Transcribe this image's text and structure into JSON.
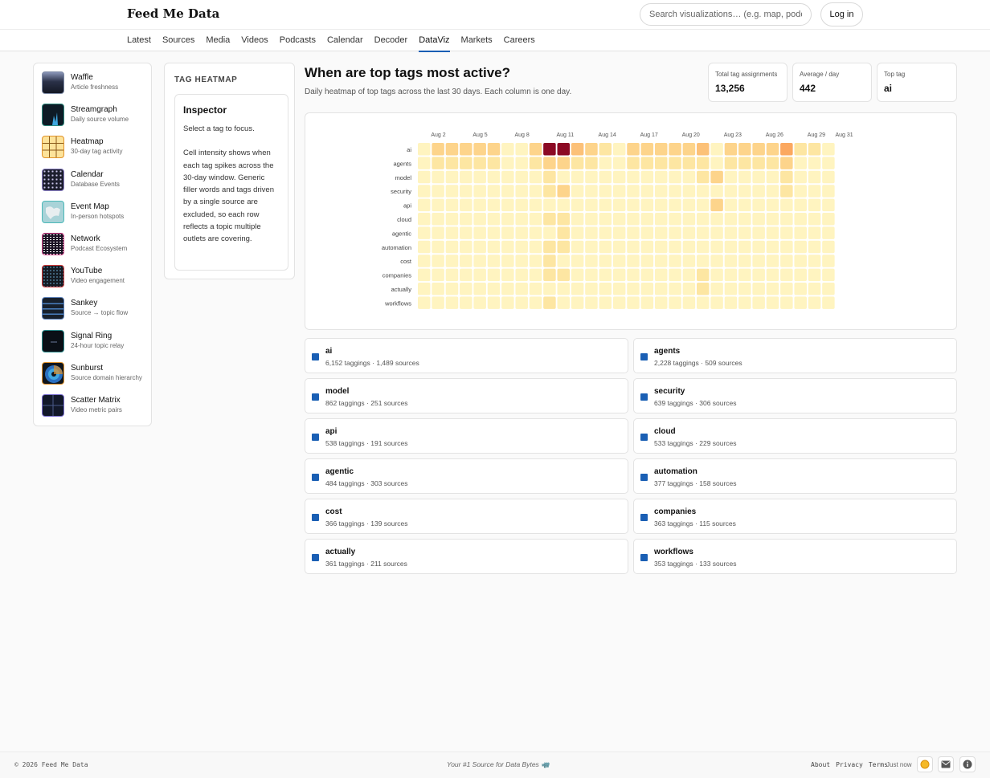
{
  "header": {
    "brand": "Feed Me Data",
    "search_placeholder": "Search visualizations… (e.g. map, podcasts)",
    "login_label": "Log in"
  },
  "nav": {
    "items": [
      "Latest",
      "Sources",
      "Media",
      "Videos",
      "Podcasts",
      "Calendar",
      "Decoder",
      "DataViz",
      "Markets",
      "Careers"
    ],
    "active": "DataViz"
  },
  "sidebar": {
    "items": [
      {
        "title": "Waffle",
        "subtitle": "Article freshness"
      },
      {
        "title": "Streamgraph",
        "subtitle": "Daily source volume"
      },
      {
        "title": "Heatmap",
        "subtitle": "30-day tag activity"
      },
      {
        "title": "Calendar",
        "subtitle": "Database Events"
      },
      {
        "title": "Event Map",
        "subtitle": "In-person hotspots"
      },
      {
        "title": "Network",
        "subtitle": "Podcast Ecosystem"
      },
      {
        "title": "YouTube",
        "subtitle": "Video engagement"
      },
      {
        "title": "Sankey",
        "subtitle": "Source → topic flow"
      },
      {
        "title": "Signal Ring",
        "subtitle": "24-hour topic relay"
      },
      {
        "title": "Sunburst",
        "subtitle": "Source domain hierarchy"
      },
      {
        "title": "Scatter Matrix",
        "subtitle": "Video metric pairs"
      }
    ]
  },
  "panel": {
    "heading": "TAG HEATMAP",
    "inspector_title": "Inspector",
    "inspector_hint": "Select a tag to focus.",
    "inspector_body": "Cell intensity shows when each tag spikes across the 30-day window. Generic filler words and tags driven by a single source are excluded, so each row reflects a topic multiple outlets are covering."
  },
  "main": {
    "title": "When are top tags most active?",
    "subtitle": "Daily heatmap of top tags across the last 30 days. Each column is one day."
  },
  "stats": [
    {
      "label": "Total tag assignments",
      "value": "13,256"
    },
    {
      "label": "Average / day",
      "value": "442"
    },
    {
      "label": "Top tag",
      "value": "ai"
    }
  ],
  "chart_data": {
    "type": "heatmap",
    "x_tick_labels": [
      "Aug 2",
      "Aug 5",
      "Aug 8",
      "Aug 11",
      "Aug 14",
      "Aug 17",
      "Aug 20",
      "Aug 23",
      "Aug 26",
      "Aug 29",
      "Aug 31"
    ],
    "rows": [
      "ai",
      "agents",
      "model",
      "security",
      "api",
      "cloud",
      "agentic",
      "automation",
      "cost",
      "companies",
      "actually",
      "workflows"
    ],
    "days": 30,
    "values": [
      [
        1,
        3,
        3,
        3,
        3,
        3,
        1,
        1,
        3,
        10,
        10,
        4,
        3,
        2,
        1,
        3,
        3,
        3,
        3,
        3,
        4,
        1,
        3,
        3,
        3,
        3,
        5,
        2,
        2,
        1
      ],
      [
        1,
        2,
        2,
        2,
        2,
        2,
        1,
        1,
        2,
        3,
        3,
        2,
        2,
        1,
        1,
        2,
        2,
        2,
        2,
        2,
        2,
        1,
        2,
        2,
        2,
        2,
        3,
        1,
        1,
        1
      ],
      [
        1,
        1,
        1,
        1,
        1,
        1,
        1,
        1,
        1,
        2,
        1,
        1,
        1,
        1,
        1,
        1,
        1,
        1,
        1,
        1,
        2,
        3,
        1,
        1,
        1,
        1,
        2,
        1,
        1,
        1
      ],
      [
        1,
        1,
        1,
        1,
        1,
        1,
        1,
        1,
        1,
        2,
        3,
        1,
        1,
        1,
        1,
        1,
        1,
        1,
        1,
        1,
        1,
        1,
        1,
        1,
        1,
        1,
        2,
        1,
        1,
        1
      ],
      [
        1,
        1,
        1,
        1,
        1,
        1,
        1,
        1,
        1,
        1,
        1,
        1,
        1,
        1,
        1,
        1,
        1,
        1,
        1,
        1,
        1,
        3,
        1,
        1,
        1,
        1,
        1,
        1,
        1,
        1
      ],
      [
        1,
        1,
        1,
        1,
        1,
        1,
        1,
        1,
        1,
        2,
        2,
        1,
        1,
        1,
        1,
        1,
        1,
        1,
        1,
        1,
        1,
        1,
        1,
        1,
        1,
        1,
        1,
        1,
        1,
        1
      ],
      [
        1,
        1,
        1,
        1,
        1,
        1,
        1,
        1,
        1,
        1,
        2,
        1,
        1,
        1,
        1,
        1,
        1,
        1,
        1,
        1,
        1,
        1,
        1,
        1,
        1,
        1,
        1,
        1,
        1,
        1
      ],
      [
        1,
        1,
        1,
        1,
        1,
        1,
        1,
        1,
        1,
        2,
        2,
        1,
        1,
        1,
        1,
        1,
        1,
        1,
        1,
        1,
        1,
        1,
        1,
        1,
        1,
        1,
        1,
        1,
        1,
        1
      ],
      [
        1,
        1,
        1,
        1,
        1,
        1,
        1,
        1,
        1,
        2,
        1,
        1,
        1,
        1,
        1,
        1,
        1,
        1,
        1,
        1,
        1,
        1,
        1,
        1,
        1,
        1,
        1,
        1,
        1,
        1
      ],
      [
        1,
        1,
        1,
        1,
        1,
        1,
        1,
        1,
        1,
        2,
        2,
        1,
        1,
        1,
        1,
        1,
        1,
        1,
        1,
        1,
        2,
        1,
        1,
        1,
        1,
        1,
        1,
        1,
        1,
        1
      ],
      [
        1,
        1,
        1,
        1,
        1,
        1,
        1,
        1,
        1,
        1,
        1,
        1,
        1,
        1,
        1,
        1,
        1,
        1,
        1,
        1,
        2,
        1,
        1,
        1,
        1,
        1,
        1,
        1,
        1,
        1
      ],
      [
        1,
        1,
        1,
        1,
        1,
        1,
        1,
        1,
        1,
        2,
        1,
        1,
        1,
        1,
        1,
        1,
        1,
        1,
        1,
        1,
        1,
        1,
        1,
        1,
        1,
        1,
        1,
        1,
        1,
        1
      ]
    ],
    "color_scale": [
      "#fffdd6",
      "#fff4c0",
      "#fde6a2",
      "#fdd48b",
      "#fcc178",
      "#fba860",
      "#f58a4b",
      "#e8653a",
      "#d23c2e",
      "#b3182b",
      "#8c0a24"
    ]
  },
  "tags": [
    {
      "name": "ai",
      "meta": "6,152 taggings · 1,489 sources"
    },
    {
      "name": "agents",
      "meta": "2,228 taggings · 509 sources"
    },
    {
      "name": "model",
      "meta": "862 taggings · 251 sources"
    },
    {
      "name": "security",
      "meta": "639 taggings · 306 sources"
    },
    {
      "name": "api",
      "meta": "538 taggings · 191 sources"
    },
    {
      "name": "cloud",
      "meta": "533 taggings · 229 sources"
    },
    {
      "name": "agentic",
      "meta": "484 taggings · 303 sources"
    },
    {
      "name": "automation",
      "meta": "377 taggings · 158 sources"
    },
    {
      "name": "cost",
      "meta": "366 taggings · 139 sources"
    },
    {
      "name": "companies",
      "meta": "363 taggings · 115 sources"
    },
    {
      "name": "actually",
      "meta": "361 taggings · 211 sources"
    },
    {
      "name": "workflows",
      "meta": "353 taggings · 133 sources"
    }
  ],
  "footer": {
    "copyright": "© 2026 Feed Me Data",
    "tagline": "Your #1 Source for Data Bytes 🦏",
    "links": [
      "About",
      "Privacy",
      "Terms"
    ],
    "updated": "Just now"
  },
  "colors": {
    "accent": "#1a5fb4",
    "theme_icon": "#f5b928"
  }
}
